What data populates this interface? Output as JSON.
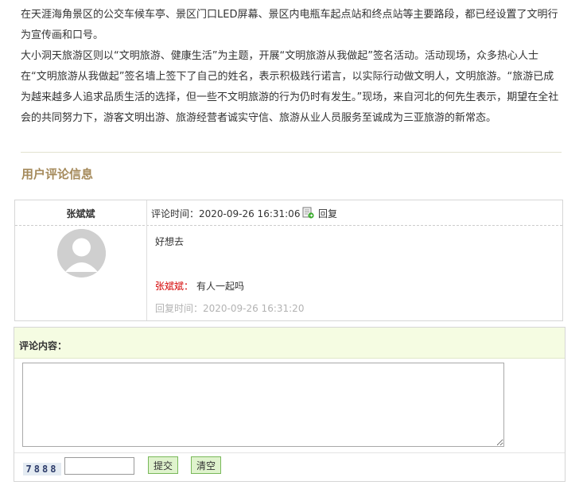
{
  "article": {
    "paragraphs": [
      "在天涯海角景区的公交车候车亭、景区门口LED屏幕、景区内电瓶车起点站和终点站等主要路段，都已经设置了文明行为宣传画和口号。",
      "大小洞天旅游区则以“文明旅游、健康生活”为主题，开展“文明旅游从我做起”签名活动。活动现场，众多热心人士在“文明旅游从我做起”签名墙上签下了自己的姓名，表示积极践行诺言，以实际行动做文明人，文明旅游。“旅游已成为越来越多人追求品质生活的选择，但一些不文明旅游的行为仍时有发生。”现场，来自河北的何先生表示，期望在全社会的共同努力下，游客文明出游、旅游经营者诚实守信、旅游从业人员服务至诚成为三亚旅游的新常态。"
    ]
  },
  "comments_section": {
    "title": "用户评论信息"
  },
  "comment": {
    "author": "张斌斌",
    "time_label": "评论时间：2020-09-26 16:31:06",
    "reply_label": "回复",
    "text": "好想去",
    "reply": {
      "author": "张斌斌：",
      "text": "有人一起吗",
      "time": "回复时间：2020-09-26 16:31:20"
    }
  },
  "form": {
    "label": "评论内容：",
    "textarea_value": "",
    "captcha_text": "7888",
    "captcha_value": "",
    "submit_label": "提交",
    "clear_label": "清空"
  },
  "colors": {
    "section_title": "#a58a5b",
    "reply_author": "#d40000",
    "form_header_bg": "#f5fce2",
    "button_bg": "#dff3cd"
  },
  "icons": {
    "reply": "reply-icon",
    "avatar": "default-avatar"
  }
}
